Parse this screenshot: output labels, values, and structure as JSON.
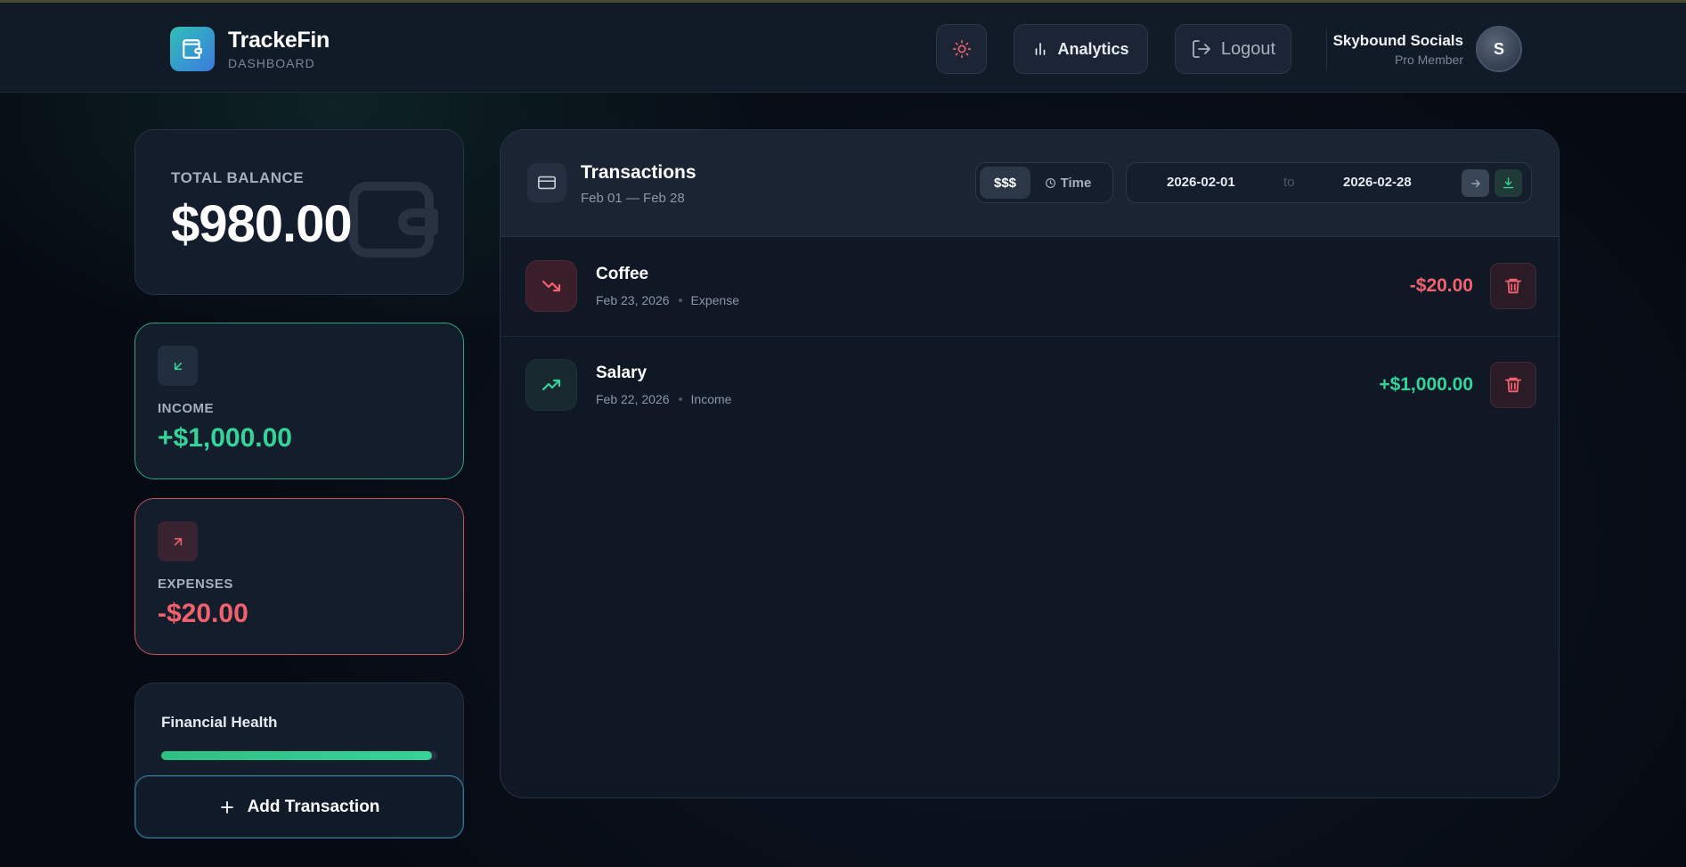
{
  "brand": {
    "name": "TrackeFin",
    "subtitle": "DASHBOARD"
  },
  "header": {
    "analytics_label": "Analytics",
    "logout_label": "Logout",
    "user_name": "Skybound Socials",
    "user_role": "Pro Member",
    "avatar_initial": "S"
  },
  "summary": {
    "balance_label": "TOTAL BALANCE",
    "balance_value": "$980.00",
    "income_label": "INCOME",
    "income_value": "+$1,000.00",
    "expenses_label": "EXPENSES",
    "expenses_value": "-$20.00",
    "health_label": "Financial Health",
    "health_fraction": 0.98
  },
  "add_button_label": "Add Transaction",
  "transactions": {
    "title": "Transactions",
    "range": "Feb 01 — Feb 28",
    "sort_money_label": "$$$",
    "sort_time_label": "Time",
    "date_from": "2026-02-01",
    "date_sep": "to",
    "date_to": "2026-02-28",
    "items": [
      {
        "name": "Coffee",
        "date": "Feb 23, 2026",
        "type": "Expense",
        "amount": "-$20.00"
      },
      {
        "name": "Salary",
        "date": "Feb 22, 2026",
        "type": "Income",
        "amount": "+$1,000.00"
      }
    ]
  },
  "colors": {
    "income": "#34d399",
    "expense": "#f2626e",
    "accent_gradient_start": "#2fc0b7",
    "accent_gradient_end": "#3b7be0"
  },
  "icons": {
    "logo": "wallet-icon",
    "theme": "sun-icon",
    "analytics": "bar-chart-icon",
    "logout": "logout-icon",
    "income": "arrow-down-left-icon",
    "expense": "arrow-up-right-icon",
    "transactions": "credit-card-icon",
    "add": "plus-icon",
    "delete": "trash-icon"
  }
}
